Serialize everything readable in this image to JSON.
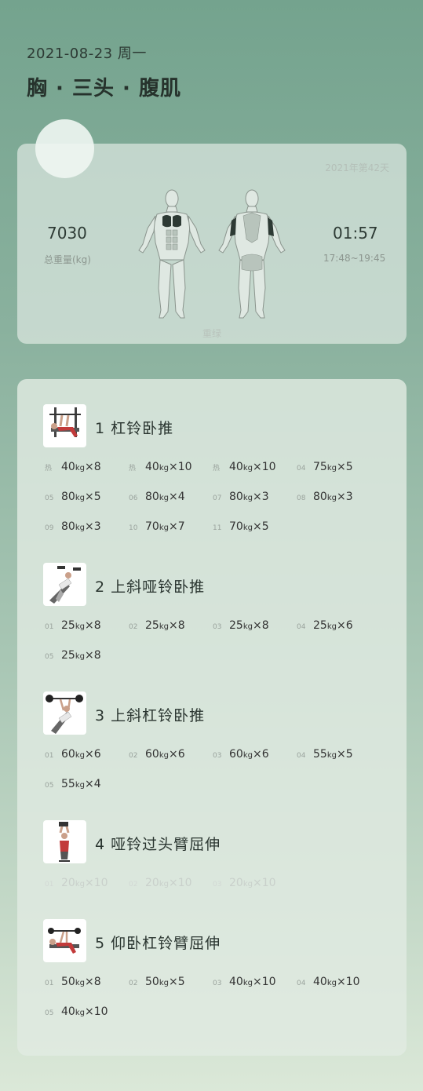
{
  "header": {
    "date": "2021-08-23 周一",
    "title": "胸 · 三头 · 腹肌"
  },
  "summary": {
    "week": "2021年第42天",
    "total_weight": "7030",
    "total_weight_label": "总重量(kg)",
    "duration": "01:57",
    "time_range": "17:48~19:45",
    "muscle_map_label": "重绿"
  },
  "exercises": [
    {
      "name": "1  杠铃卧推",
      "sets": [
        {
          "tag": "热",
          "weight": "40",
          "unit": "kg",
          "reps": "×8"
        },
        {
          "tag": "热",
          "weight": "40",
          "unit": "kg",
          "reps": "×10"
        },
        {
          "tag": "热",
          "weight": "40",
          "unit": "kg",
          "reps": "×10"
        },
        {
          "tag": "04",
          "weight": "75",
          "unit": "kg",
          "reps": "×5"
        },
        {
          "tag": "05",
          "weight": "80",
          "unit": "kg",
          "reps": "×5"
        },
        {
          "tag": "06",
          "weight": "80",
          "unit": "kg",
          "reps": "×4"
        },
        {
          "tag": "07",
          "weight": "80",
          "unit": "kg",
          "reps": "×3"
        },
        {
          "tag": "08",
          "weight": "80",
          "unit": "kg",
          "reps": "×3"
        },
        {
          "tag": "09",
          "weight": "80",
          "unit": "kg",
          "reps": "×3"
        },
        {
          "tag": "10",
          "weight": "70",
          "unit": "kg",
          "reps": "×7"
        },
        {
          "tag": "11",
          "weight": "70",
          "unit": "kg",
          "reps": "×5"
        }
      ]
    },
    {
      "name": "2  上斜哑铃卧推",
      "sets": [
        {
          "tag": "01",
          "weight": "25",
          "unit": "kg",
          "reps": "×8"
        },
        {
          "tag": "02",
          "weight": "25",
          "unit": "kg",
          "reps": "×8"
        },
        {
          "tag": "03",
          "weight": "25",
          "unit": "kg",
          "reps": "×8"
        },
        {
          "tag": "04",
          "weight": "25",
          "unit": "kg",
          "reps": "×6"
        },
        {
          "tag": "05",
          "weight": "25",
          "unit": "kg",
          "reps": "×8"
        }
      ]
    },
    {
      "name": "3  上斜杠铃卧推",
      "sets": [
        {
          "tag": "01",
          "weight": "60",
          "unit": "kg",
          "reps": "×6"
        },
        {
          "tag": "02",
          "weight": "60",
          "unit": "kg",
          "reps": "×6"
        },
        {
          "tag": "03",
          "weight": "60",
          "unit": "kg",
          "reps": "×6"
        },
        {
          "tag": "04",
          "weight": "55",
          "unit": "kg",
          "reps": "×5"
        },
        {
          "tag": "05",
          "weight": "55",
          "unit": "kg",
          "reps": "×4"
        }
      ]
    },
    {
      "name": "4  哑铃过头臂屈伸",
      "sets": [
        {
          "tag": "01",
          "weight": "20",
          "unit": "kg",
          "reps": "×10"
        },
        {
          "tag": "02",
          "weight": "20",
          "unit": "kg",
          "reps": "×10"
        },
        {
          "tag": "03",
          "weight": "20",
          "unit": "kg",
          "reps": "×10"
        }
      ]
    },
    {
      "name": "5  仰卧杠铃臂屈伸",
      "sets": [
        {
          "tag": "01",
          "weight": "50",
          "unit": "kg",
          "reps": "×8"
        },
        {
          "tag": "02",
          "weight": "50",
          "unit": "kg",
          "reps": "×5"
        },
        {
          "tag": "03",
          "weight": "40",
          "unit": "kg",
          "reps": "×10"
        },
        {
          "tag": "04",
          "weight": "40",
          "unit": "kg",
          "reps": "×10"
        },
        {
          "tag": "05",
          "weight": "40",
          "unit": "kg",
          "reps": "×10"
        }
      ]
    }
  ]
}
